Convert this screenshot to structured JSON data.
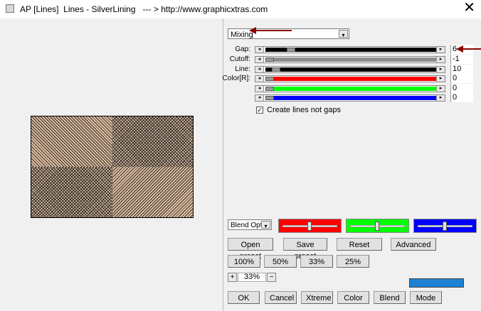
{
  "window": {
    "title": "AP [Lines]  Lines - SilverLining   --- > http://www.graphicxtras.com",
    "close_glyph": "✕"
  },
  "mode_select": {
    "value": "Mixing"
  },
  "params": [
    {
      "label": "Gap:",
      "value": "6",
      "fill": "#000000",
      "thumb_pos": 0.13
    },
    {
      "label": "Cutoff:",
      "value": "-1",
      "fill": "#8c8c8c",
      "thumb_pos": 0.0
    },
    {
      "label": "Line:",
      "value": "10",
      "fill": "#000000",
      "thumb_pos": 0.04
    },
    {
      "label": "Color[R]:",
      "value": "0",
      "fill": "#ff0000",
      "thumb_pos": 0.0
    },
    {
      "label": "",
      "value": "0",
      "fill": "#00ff00",
      "thumb_pos": 0.0
    },
    {
      "label": "",
      "value": "0",
      "fill": "#0000ff",
      "thumb_pos": 0.0
    }
  ],
  "create_lines": {
    "label": "Create lines not gaps",
    "checked": true,
    "check_glyph": "✓"
  },
  "blend_select": {
    "value": "Blend Opti"
  },
  "color_sliders": [
    {
      "color": "#ff0000",
      "level": 0.5
    },
    {
      "color": "#00ff00",
      "level": 0.5
    },
    {
      "color": "#0000ff",
      "level": 0.5
    }
  ],
  "buttons": {
    "open_preset": "Open preset",
    "save_preset": "Save preset",
    "reset": "Reset",
    "advanced": "Advanced",
    "zoom_100": "100%",
    "zoom_50": "50%",
    "zoom_33": "33%",
    "zoom_25": "25%",
    "ok": "OK",
    "cancel": "Cancel",
    "xtreme": "Xtreme",
    "color": "Color",
    "blend": "Blend",
    "mode": "Mode"
  },
  "zoom": {
    "plus": "+",
    "value": "33%",
    "minus": "−"
  },
  "colors": {
    "preview_bg": "#e2c0a0",
    "line_color": "#2b2b2b",
    "swatch": "#1e82d2",
    "annotation_arrow": "#8b0000"
  },
  "icons": {
    "dropdown": "▾",
    "scroll_left": "◂",
    "scroll_right": "▸"
  }
}
